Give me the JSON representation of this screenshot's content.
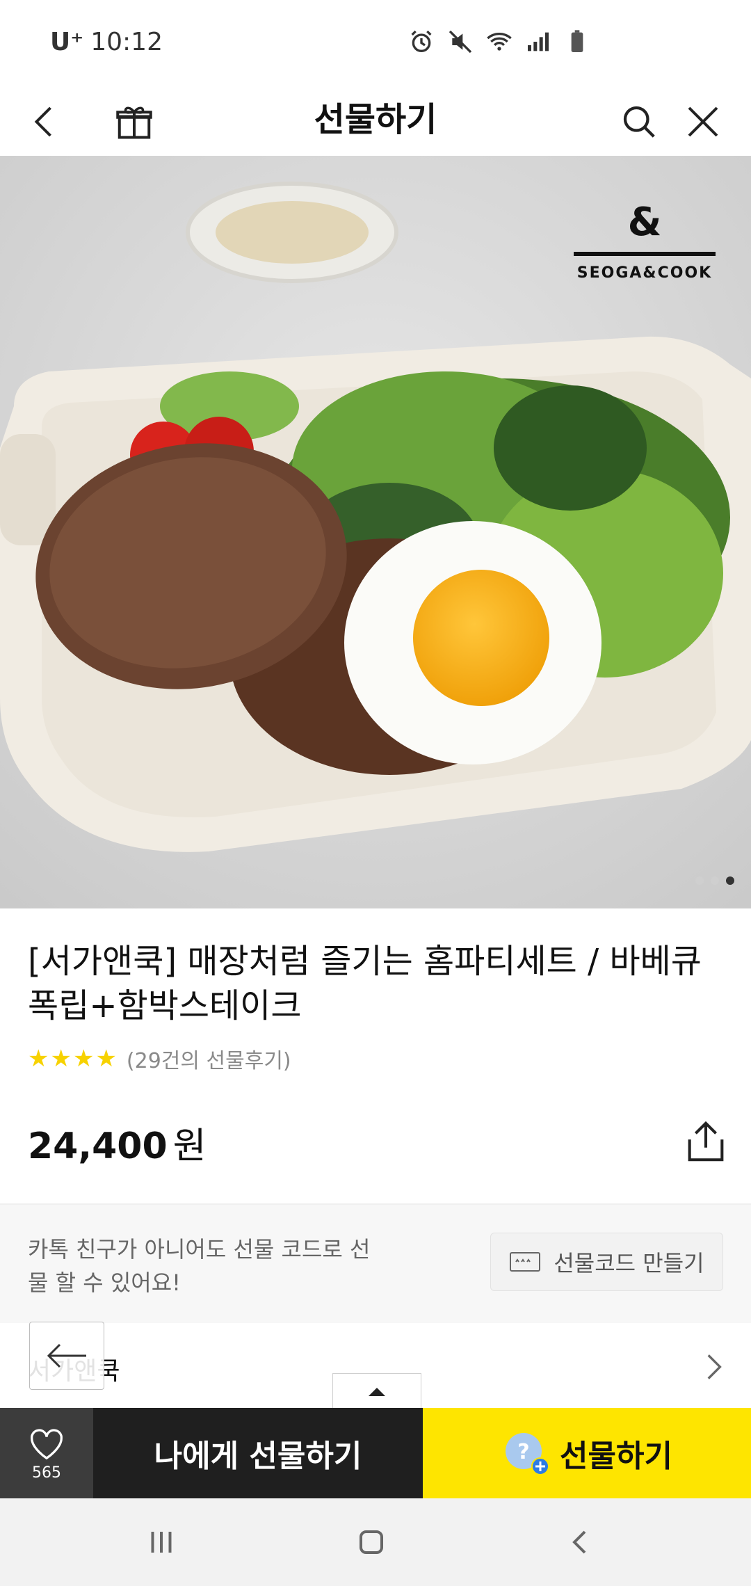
{
  "status_bar": {
    "carrier": "U⁺",
    "time": "10:12"
  },
  "header": {
    "title": "선물하기"
  },
  "hero": {
    "brand_mark": "&",
    "brand_name": "SEOGA&COOK",
    "carousel_total": 3,
    "carousel_active": 3
  },
  "product": {
    "title": "[서가앤쿡] 매장처럼 즐기는 홈파티세트 / 바베큐 폭립+함박스테이크",
    "stars": "★★★★",
    "review_text": "(29건의 선물후기)",
    "price": "24,400",
    "price_unit": "원"
  },
  "giftcode": {
    "description": "카톡 친구가 아니어도 선물 코드로 선물 할 수 있어요!",
    "button_label": "선물코드 만들기"
  },
  "brand_row": {
    "name": "서가앤쿡"
  },
  "action_bar": {
    "wish_count": "565",
    "to_me_label": "나에게 선물하기",
    "gift_label": "선물하기"
  },
  "colors": {
    "accent_yellow": "#fee500",
    "dark_button": "#1f1f1f",
    "star": "#f7d200"
  }
}
